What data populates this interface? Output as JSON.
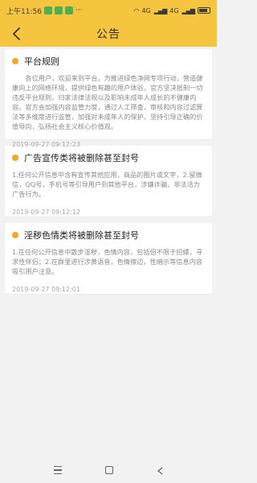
{
  "status": {
    "time": "上午11:56",
    "network": "4G",
    "battery": "4G"
  },
  "header": {
    "title": "公告"
  },
  "notices": [
    {
      "title": "平台规则",
      "body": "各位用户，欢迎来到平台。为推进绿色净网专项行动，营造健康向上的网络环境，提供绿色有趣的用户体验，官方坚决抵制一切违反平台规则，归家法律法规以及影响未成年人成长的不健康内容。官方会加强内容监管力度，通过人工筛查，审核和内容过滤算法等多维度进行监管，加强对未成年人的保护，坚持引导正确的价值导向，弘扬社会主义核心价值观。",
      "time": "2019-09-27 09:12:23"
    },
    {
      "title": "广告宣传类将被删除甚至封号",
      "body": "1.任何公开信息中含有宣传其他应用，商品的图片或文字，2.留微信，QQ号，手机号等引导用户到其他平台，涉嫌诈骗，非法活力广告行为。",
      "time": "2019-09-27 09:12:12"
    },
    {
      "title": "淫秽色情类将被删除甚至封号",
      "body": "1.在任何公开信息中散步淫秽，色情内容，包括但不限于招嫖，寻求性伴侣；2.在群里进行涉黄语音，色情擦边，性暗示等信息内容吸引用户注意。",
      "time": "2019-09-27 09:12:01"
    }
  ],
  "colors": {
    "header_bg": "#f6c53f",
    "dot": "#f5a623",
    "page_bg": "#f2f2f2"
  }
}
